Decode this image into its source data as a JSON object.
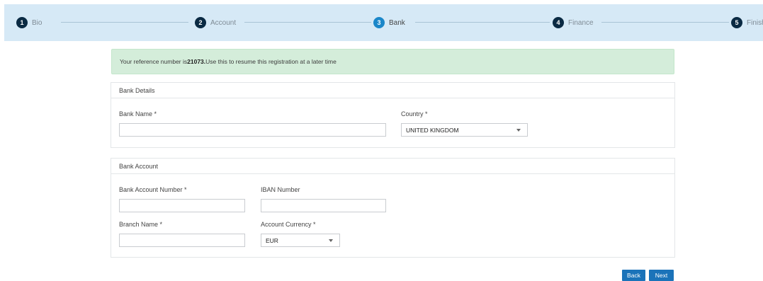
{
  "stepper": {
    "steps": [
      {
        "num": "1",
        "label": "Bio"
      },
      {
        "num": "2",
        "label": "Account"
      },
      {
        "num": "3",
        "label": "Bank"
      },
      {
        "num": "4",
        "label": "Finance"
      },
      {
        "num": "5",
        "label": "Finish"
      }
    ],
    "active_step": "Bank",
    "colors": {
      "background": "#d6e9f6",
      "done": "#0a2a43",
      "active": "#1b87c9"
    }
  },
  "alert": {
    "prefix": "Your reference number is ",
    "reference_number": "21073.",
    "suffix": " Use this to resume this registration at a later time"
  },
  "bank_details": {
    "heading": "Bank Details",
    "bank_name_label": "Bank Name *",
    "bank_name_value": "",
    "country_label": "Country *",
    "country_value": "UNITED KINGDOM"
  },
  "bank_account": {
    "heading": "Bank Account",
    "account_number_label": "Bank Account Number *",
    "account_number_value": "",
    "iban_label": "IBAN Number",
    "iban_value": "",
    "branch_name_label": "Branch Name *",
    "branch_name_value": "",
    "currency_label": "Account Currency *",
    "currency_value": "EUR"
  },
  "buttons": {
    "back": "Back",
    "next": "Next",
    "color": "#1b73b9"
  }
}
